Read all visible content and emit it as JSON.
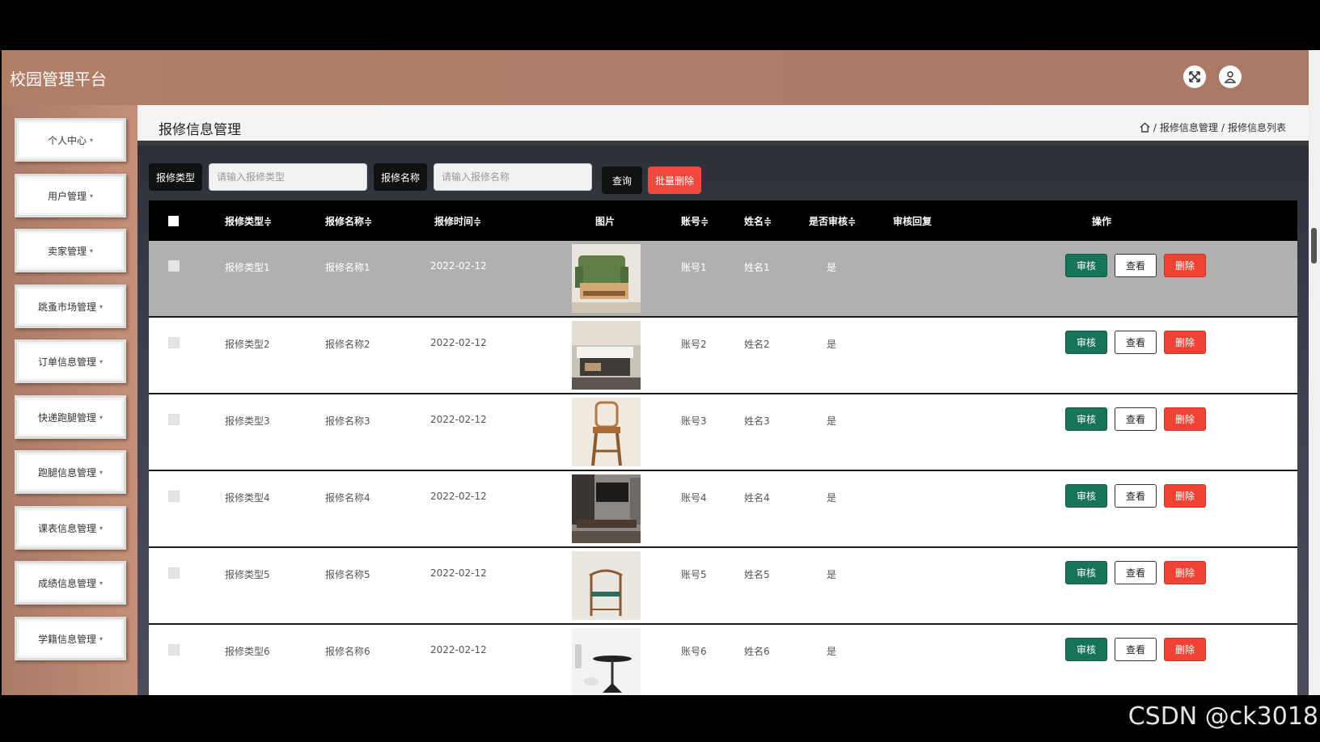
{
  "app": {
    "title": "校园管理平台"
  },
  "header": {
    "fullscreen_icon": "expand-icon",
    "user_icon": "user-icon"
  },
  "sidebar": {
    "items": [
      {
        "label": "个人中心"
      },
      {
        "label": "用户管理"
      },
      {
        "label": "卖家管理"
      },
      {
        "label": "跳蚤市场管理"
      },
      {
        "label": "订单信息管理"
      },
      {
        "label": "快递跑腿管理"
      },
      {
        "label": "跑腿信息管理"
      },
      {
        "label": "课表信息管理"
      },
      {
        "label": "成绩信息管理"
      },
      {
        "label": "学籍信息管理"
      }
    ]
  },
  "page": {
    "title": "报修信息管理",
    "breadcrumb": {
      "level1": "报修信息管理",
      "level2": "报修信息列表",
      "sep": "/"
    }
  },
  "search": {
    "type_label": "报修类型",
    "type_placeholder": "请输入报修类型",
    "name_label": "报修名称",
    "name_placeholder": "请输入报修名称",
    "query_label": "查询",
    "batch_delete_label": "批量删除"
  },
  "table": {
    "columns": [
      "报修类型",
      "报修名称",
      "报修时间",
      "图片",
      "账号",
      "姓名",
      "是否审核",
      "审核回复",
      "操作"
    ],
    "sort_mark": "≑",
    "rows": [
      {
        "type": "报修类型1",
        "name": "报修名称1",
        "time": "2022-02-12",
        "account": "账号1",
        "person": "姓名1",
        "audited": "是",
        "reply": "",
        "img": "sofa"
      },
      {
        "type": "报修类型2",
        "name": "报修名称2",
        "time": "2022-02-12",
        "account": "账号2",
        "person": "姓名2",
        "audited": "是",
        "reply": "",
        "img": "table"
      },
      {
        "type": "报修类型3",
        "name": "报修名称3",
        "time": "2022-02-12",
        "account": "账号3",
        "person": "姓名3",
        "audited": "是",
        "reply": "",
        "img": "chair"
      },
      {
        "type": "报修类型4",
        "name": "报修名称4",
        "time": "2022-02-12",
        "account": "账号4",
        "person": "姓名4",
        "audited": "是",
        "reply": "",
        "img": "tv-cabinet"
      },
      {
        "type": "报修类型5",
        "name": "报修名称5",
        "time": "2022-02-12",
        "account": "账号5",
        "person": "姓名5",
        "audited": "是",
        "reply": "",
        "img": "armchair"
      },
      {
        "type": "报修类型6",
        "name": "报修名称6",
        "time": "2022-02-12",
        "account": "账号6",
        "person": "姓名6",
        "audited": "是",
        "reply": "",
        "img": "side-table"
      }
    ],
    "actions": {
      "audit": "审核",
      "view": "查看",
      "delete": "删除"
    }
  },
  "watermark": "CSDN @ck3018",
  "colors": {
    "header": "#ab7b65",
    "audit": "#177458",
    "delete": "#f04336",
    "batch_delete": "#f0473e"
  }
}
